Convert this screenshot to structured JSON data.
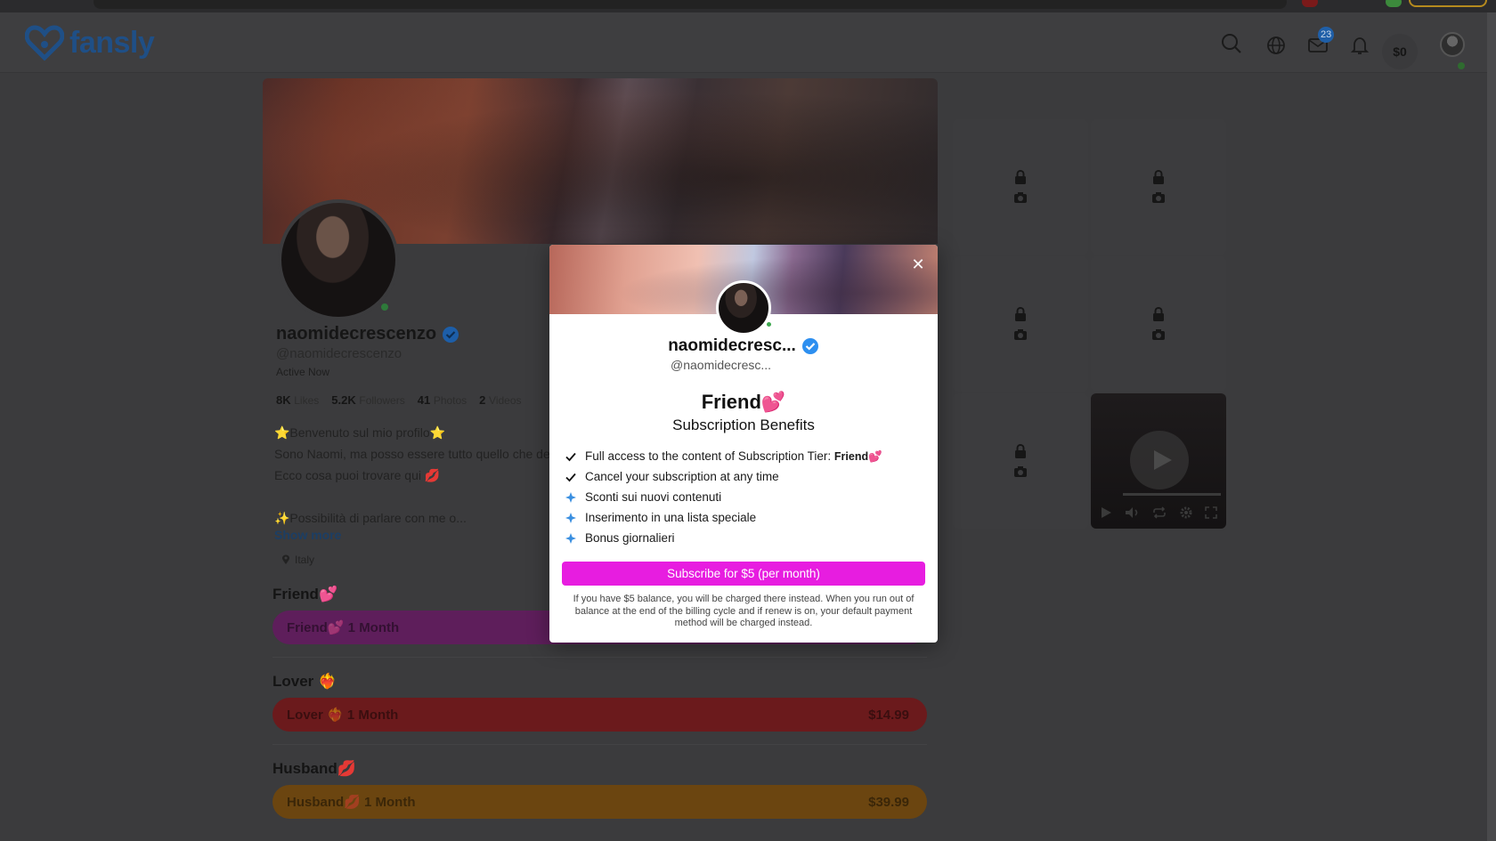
{
  "brand": {
    "name": "fansly",
    "color": "#1f4f86"
  },
  "header": {
    "message_count": "23",
    "wallet_balance": "$0"
  },
  "profile": {
    "name": "naomidecrescenzo",
    "handle": "@naomidecrescenzo",
    "status": "Active Now",
    "stats": [
      {
        "value": "8K",
        "label": "Likes"
      },
      {
        "value": "5.2K",
        "label": "Followers"
      },
      {
        "value": "41",
        "label": "Photos"
      },
      {
        "value": "2",
        "label": "Videos"
      }
    ],
    "bio_lines": [
      "⭐Benvenuto sul mio profilo⭐",
      "Sono Naomi, ma posso essere tutto quello che desideri",
      "Ecco cosa puoi trovare qui 💋",
      "",
      "✨Possibilità di parlare con me o..."
    ],
    "show_more": "Show more",
    "location": "Italy"
  },
  "tiers": [
    {
      "title": "Friend💕",
      "label": "Friend💕 1 Month",
      "price": "",
      "color": "#5e1e5b"
    },
    {
      "title": "Lover ❤️‍🔥",
      "label": "Lover ❤️‍🔥 1 Month",
      "price": "$14.99",
      "color": "#6b1a1c"
    },
    {
      "title": "Husband💋",
      "label": "Husband💋 1 Month",
      "price": "$39.99",
      "color": "#6b4510"
    }
  ],
  "modal": {
    "name": "naomidecresc...",
    "handle": "@naomidecresc...",
    "tier_name": "Friend💕",
    "subtitle": "Subscription Benefits",
    "benefits": [
      {
        "icon": "check-icon",
        "text": "Full access to the content of Subscription Tier:",
        "emphasis": "Friend💕"
      },
      {
        "icon": "check-icon",
        "text": "Cancel your subscription at any time",
        "emphasis": ""
      },
      {
        "icon": "sparkle-icon",
        "text": "Sconti sui nuovi contenuti",
        "emphasis": ""
      },
      {
        "icon": "sparkle-icon",
        "text": "Inserimento in una lista speciale",
        "emphasis": ""
      },
      {
        "icon": "sparkle-icon",
        "text": "Bonus giornalieri",
        "emphasis": ""
      }
    ],
    "subscribe_label": "Subscribe for $5 (per month)",
    "note": "If you have $5 balance, you will be charged there instead. When you run out of balance at the end of the billing cycle and if renew is on, your default payment method will be charged instead.",
    "accent": "#e71de0"
  },
  "media": {
    "locked_tiles": 5,
    "video_tiles": 1
  }
}
